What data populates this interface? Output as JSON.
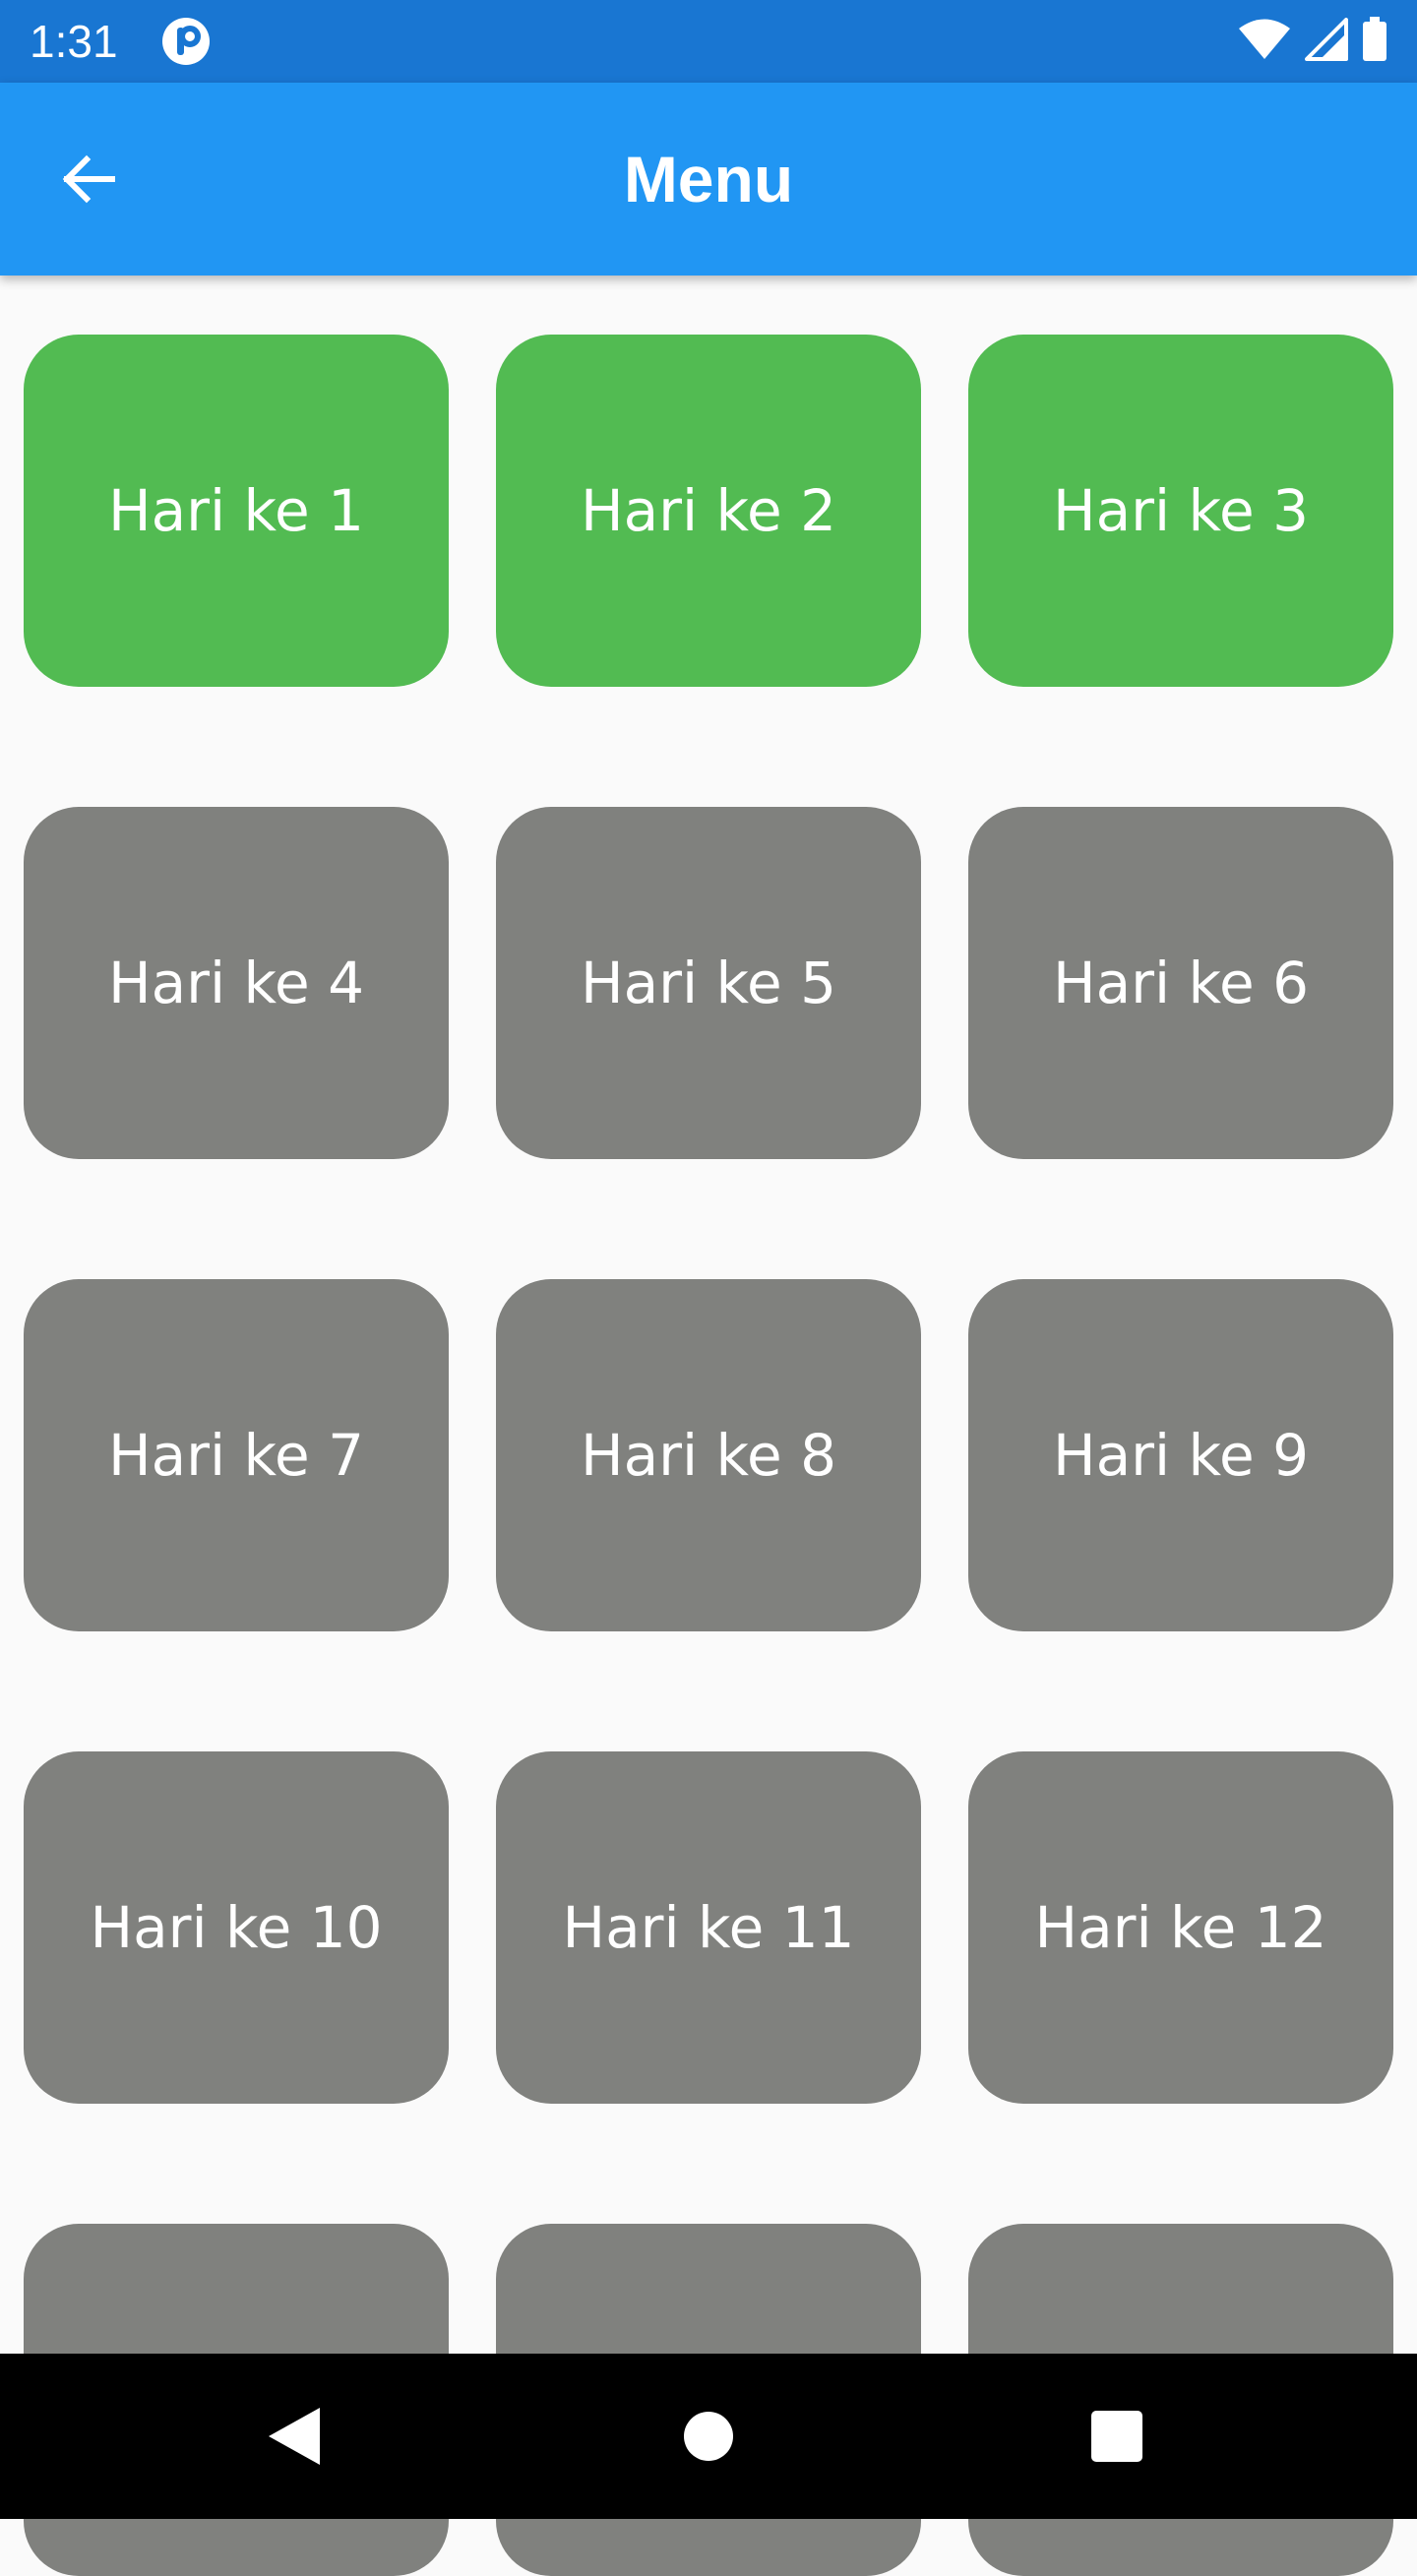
{
  "status_bar": {
    "time": "1:31",
    "icons": [
      "app-notification-icon",
      "wifi-icon",
      "cell-signal-icon",
      "battery-icon"
    ]
  },
  "app_bar": {
    "title": "Menu",
    "back_icon": "arrow-back-icon"
  },
  "colors": {
    "status_bar": "#1976d2",
    "app_bar": "#2196f3",
    "completed_tile": "#52bb52",
    "locked_tile": "#80817e",
    "background": "#fafafa"
  },
  "days": [
    {
      "label": "Hari ke 1",
      "state": "completed"
    },
    {
      "label": "Hari ke 2",
      "state": "completed"
    },
    {
      "label": "Hari ke 3",
      "state": "completed"
    },
    {
      "label": "Hari ke 4",
      "state": "locked"
    },
    {
      "label": "Hari ke 5",
      "state": "locked"
    },
    {
      "label": "Hari ke 6",
      "state": "locked"
    },
    {
      "label": "Hari ke 7",
      "state": "locked"
    },
    {
      "label": "Hari ke 8",
      "state": "locked"
    },
    {
      "label": "Hari ke 9",
      "state": "locked"
    },
    {
      "label": "Hari ke 10",
      "state": "locked"
    },
    {
      "label": "Hari ke 11",
      "state": "locked"
    },
    {
      "label": "Hari ke 12",
      "state": "locked"
    },
    {
      "label": "",
      "state": "locked"
    },
    {
      "label": "",
      "state": "locked"
    },
    {
      "label": "",
      "state": "locked"
    }
  ],
  "nav_bar": {
    "icons": [
      "nav-back-icon",
      "nav-home-icon",
      "nav-recents-icon"
    ]
  }
}
